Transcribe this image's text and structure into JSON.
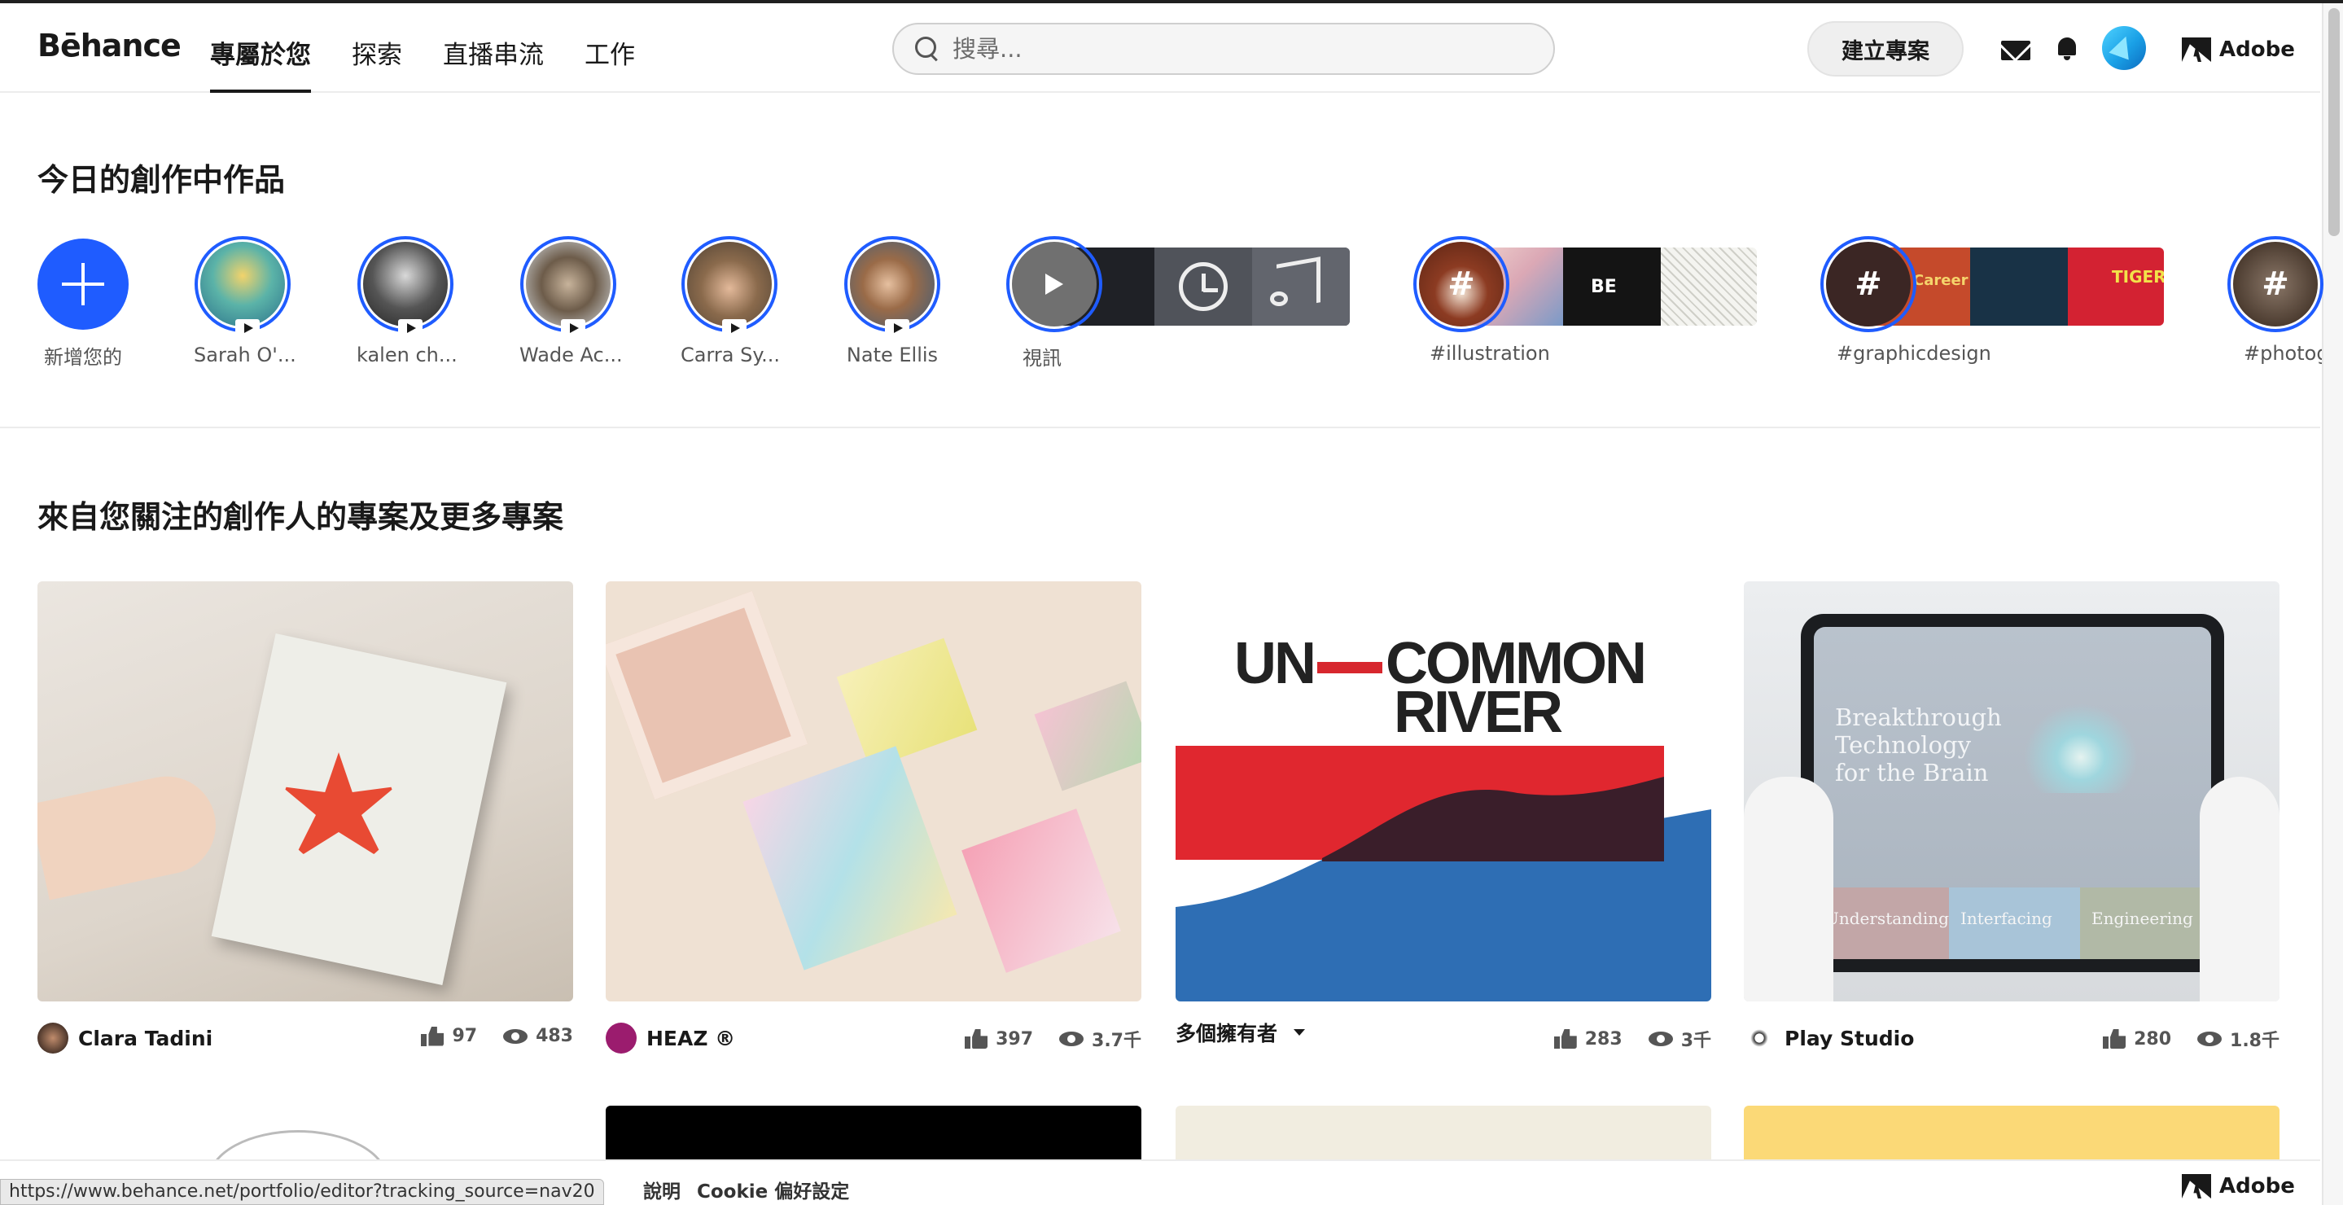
{
  "nav": {
    "logo": "Bēhance",
    "tabs": [
      "專屬於您",
      "探索",
      "直播串流",
      "工作"
    ],
    "search_placeholder": "搜尋...",
    "create_label": "建立專案",
    "adobe_label": "Adobe"
  },
  "stories": {
    "title": "今日的創作中作品",
    "add_label": "新增您的",
    "creators": [
      "Sarah O'...",
      "kalen ch...",
      "Wade Ac...",
      "Carra Sy...",
      "Nate Ellis"
    ],
    "video_label": "視訊",
    "tags": [
      "#illustration",
      "#graphicdesign",
      "#photog"
    ]
  },
  "projects": {
    "title": "來自您關注的創作人的專案及更多專案",
    "items": [
      {
        "owner": "Clara Tadini",
        "likes": "97",
        "views": "483"
      },
      {
        "owner": "HEAZ ®",
        "likes": "397",
        "views": "3.7千"
      },
      {
        "owner": "多個擁有者",
        "likes": "283",
        "views": "3千",
        "thumb_text_1": "UN",
        "thumb_text_2": "COMMON",
        "thumb_text_3": "RIVER"
      },
      {
        "owner": "Play Studio",
        "likes": "280",
        "views": "1.8千",
        "thumb_text": "Breakthrough Technology for the Brain",
        "tabs": [
          "Understanding",
          "Interfacing",
          "Engineering"
        ]
      }
    ]
  },
  "footer": {
    "status_url": "https://www.behance.net/portfolio/editor?tracking_source=nav20",
    "links": [
      "說明",
      "Cookie 偏好設定"
    ],
    "adobe_label": "Adobe"
  }
}
